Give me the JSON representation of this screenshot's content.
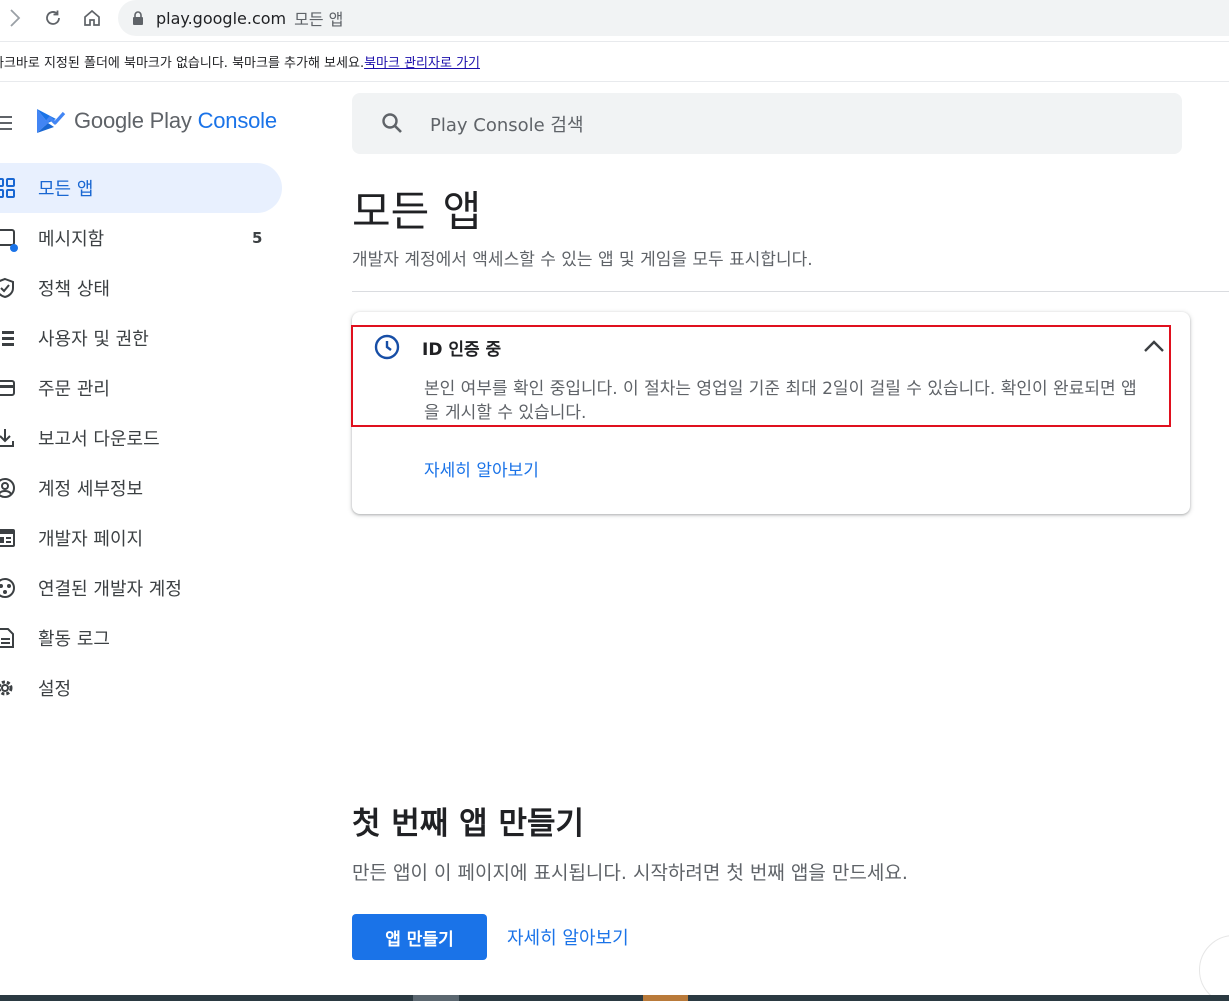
{
  "browser": {
    "url_host": "play.google.com",
    "url_path": "모든 앱"
  },
  "bookmarks": {
    "message": "바로가기로 지정된 폴더에 북마크가 없습니다. 북마크를 추가해 보세요.",
    "message_visible": "라크바로 지정된 폴더에 북마크가 없습니다. 북마크를 추가해 보세요.",
    "link": "북마크 관리자로 가기"
  },
  "brand": {
    "google_play": "Google Play",
    "console": "Console"
  },
  "sidebar": {
    "items": [
      {
        "label": "모든 앱",
        "icon": "apps-grid-icon",
        "active": true
      },
      {
        "label": "메시지함",
        "icon": "inbox-icon",
        "count": "5",
        "unread_dot": true
      },
      {
        "label": "정책 상태",
        "icon": "shield-icon"
      },
      {
        "label": "사용자 및 권한",
        "icon": "users-list-icon"
      },
      {
        "label": "주문 관리",
        "icon": "credit-card-icon"
      },
      {
        "label": "보고서 다운로드",
        "icon": "download-icon"
      },
      {
        "label": "계정 세부정보",
        "icon": "account-circle-icon"
      },
      {
        "label": "개발자 페이지",
        "icon": "web-page-icon"
      },
      {
        "label": "연결된 개발자 계정",
        "icon": "linked-accounts-icon"
      },
      {
        "label": "활동 로그",
        "icon": "document-icon"
      },
      {
        "label": "설정",
        "icon": "gear-icon"
      }
    ]
  },
  "search": {
    "placeholder": "Play Console 검색"
  },
  "main": {
    "title": "모든 앱",
    "subtitle": "개발자 계정에서 액세스할 수 있는 앱 및 게임을 모두 표시합니다.",
    "card": {
      "title": "ID 인증 중",
      "body": "본인 여부를 확인 중입니다. 이 절차는 영업일 기준 최대 2일이 걸릴 수 있습니다. 확인이 완료되면 앱을 게시할 수 있습니다.",
      "link": "자세히 알아보기"
    },
    "first_app": {
      "title": "첫 번째 앱 만들기",
      "subtitle": "만든 앱이 이 페이지에 표시됩니다. 시작하려면 첫 번째 앱을 만드세요.",
      "create_button": "앱 만들기",
      "learn_more": "자세히 알아보기"
    }
  },
  "colors": {
    "accent": "#1a73e8",
    "active_bg": "#e8f0fe",
    "highlight_border": "#e0101e"
  }
}
